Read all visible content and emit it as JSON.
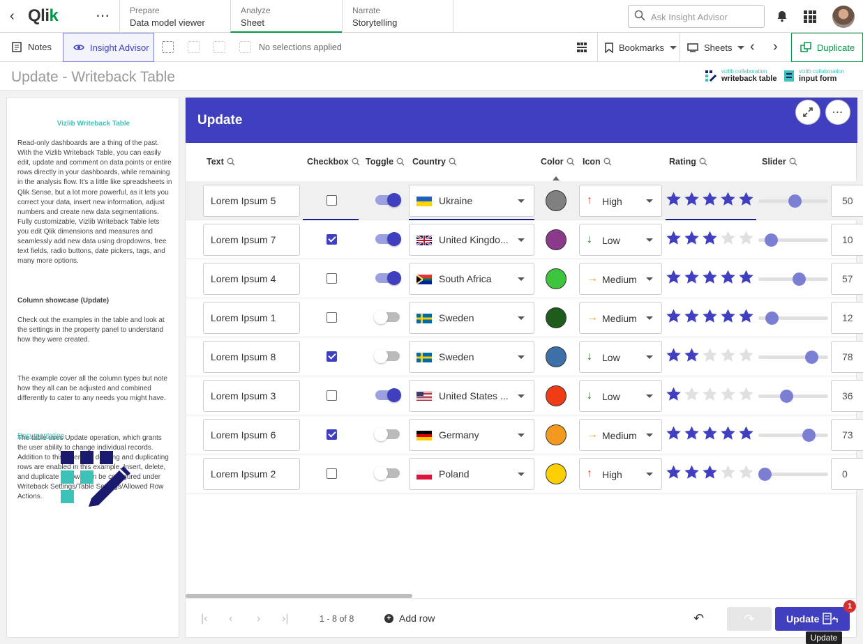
{
  "app": {
    "logo_text": "Qlik",
    "tabs": [
      {
        "small": "Prepare",
        "big": "Data model viewer"
      },
      {
        "small": "Analyze",
        "big": "Sheet"
      },
      {
        "small": "Narrate",
        "big": "Storytelling"
      }
    ],
    "search_placeholder": "Ask Insight Advisor",
    "accent_color": "#009845"
  },
  "toolbar": {
    "notes": "Notes",
    "insight_advisor": "Insight Advisor",
    "no_selections": "No selections applied",
    "bookmarks": "Bookmarks",
    "sheets": "Sheets",
    "duplicate": "Duplicate"
  },
  "sheet": {
    "title": "Update - Writeback Table",
    "brand1_small": "vizlib collaboration",
    "brand1_main": "writeback table",
    "brand2_small": "vizlib collaboration",
    "brand2_main": "input form"
  },
  "left_panel": {
    "title": "Vizlib Writeback Table",
    "intro": "Read-only dashboards are a thing of the past. With the Vizlib Writeback Table, you can easily edit, update and comment on data points or entire rows directly in your dashboards, while remaining in the analysis flow. It's a little like spreadsheets in Qlik Sense, but a lot more powerful, as it lets you correct your data, insert new information, adjust numbers and create new data segmentations. Fully customizable, Vizlib Writeback Table lets you edit Qlik dimensions and measures and seamlessly add new data using dropdowns, free text fields, radio buttons, date pickers, tags, and many more options.",
    "showcase_heading": "Column showcase (Update)",
    "showcase_text": "Check out the examples in the table and look at the settings in the property panel to understand how they were created.",
    "para2": "The example cover all the column types but note how they all can be adjusted and combined differently to cater to any needs you might have.",
    "para3": "The table uses Update operation, which grants the user ability to change individual records. Addition to this inserting, deleting and duplicating rows are enabled in this example. Insert, delete, and duplicate of rows can be configured under Writeback Settings/Table Settings/Allowed Row Actions.",
    "doc_link": "Documentation"
  },
  "widget": {
    "title": "Update",
    "header_color": "#3f3fbf",
    "columns": [
      "Text",
      "Checkbox",
      "Toggle",
      "Country",
      "Color",
      "Icon",
      "Rating",
      "Slider"
    ],
    "rows": [
      {
        "text": "Lorem Ipsum 5",
        "checkbox": false,
        "toggle": true,
        "country": "Ukraine",
        "flag": "ukraine",
        "color": "#808080",
        "icon": "up",
        "icon_label": "High",
        "rating": 5,
        "slider": 0.5,
        "num": "50"
      },
      {
        "text": "Lorem Ipsum 7",
        "checkbox": true,
        "toggle": true,
        "country": "United Kingdo...",
        "flag": "uk",
        "color": "#8b3a8b",
        "icon": "down",
        "icon_label": "Low",
        "rating": 3,
        "slider": 0.1,
        "num": "10"
      },
      {
        "text": "Lorem Ipsum 4",
        "checkbox": false,
        "toggle": true,
        "country": "South Africa",
        "flag": "za",
        "color": "#3cc43c",
        "icon": "right",
        "icon_label": "Medium",
        "rating": 5,
        "slider": 0.57,
        "num": "57"
      },
      {
        "text": "Lorem Ipsum 1",
        "checkbox": false,
        "toggle": false,
        "country": "Sweden",
        "flag": "se",
        "color": "#1e5c1e",
        "icon": "right",
        "icon_label": "Medium",
        "rating": 5,
        "slider": 0.12,
        "num": "12"
      },
      {
        "text": "Lorem Ipsum 8",
        "checkbox": true,
        "toggle": false,
        "country": "Sweden",
        "flag": "se",
        "color": "#3d6fa8",
        "icon": "down",
        "icon_label": "Low",
        "rating": 2,
        "slider": 0.78,
        "num": "78"
      },
      {
        "text": "Lorem Ipsum 3",
        "checkbox": false,
        "toggle": true,
        "country": "United States ...",
        "flag": "us",
        "color": "#f03c16",
        "icon": "down",
        "icon_label": "Low",
        "rating": 1,
        "slider": 0.36,
        "num": "36"
      },
      {
        "text": "Lorem Ipsum 6",
        "checkbox": true,
        "toggle": false,
        "country": "Germany",
        "flag": "de",
        "color": "#f39a1e",
        "icon": "right",
        "icon_label": "Medium",
        "rating": 5,
        "slider": 0.73,
        "num": "73"
      },
      {
        "text": "Lorem Ipsum 2",
        "checkbox": false,
        "toggle": false,
        "country": "Poland",
        "flag": "pl",
        "color": "#fccf00",
        "icon": "up",
        "icon_label": "High",
        "rating": 3,
        "slider": 0.0,
        "num": "0"
      }
    ],
    "page_info": "1 - 8 of 8",
    "add_row": "Add row",
    "update_button": "Update",
    "badge_count": "1",
    "tooltip": "Update"
  }
}
